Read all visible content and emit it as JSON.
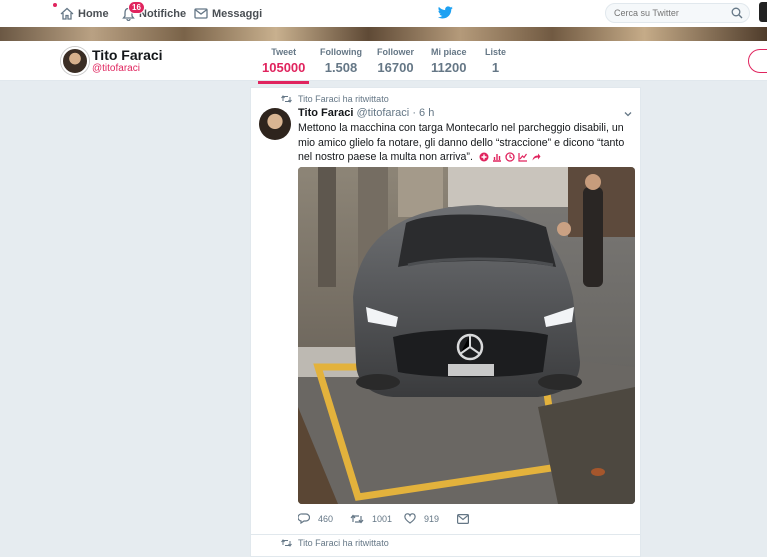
{
  "nav": {
    "home": "Home",
    "notifications": "Notifiche",
    "notifications_badge": "16",
    "messages": "Messaggi",
    "search_placeholder": "Cerca su Twitter"
  },
  "profile": {
    "name": "Tito Faraci",
    "handle": "@titofaraci",
    "stats": [
      {
        "label": "Tweet",
        "value": "105000"
      },
      {
        "label": "Following",
        "value": "1.508"
      },
      {
        "label": "Follower",
        "value": "16700"
      },
      {
        "label": "Mi piace",
        "value": "11200"
      },
      {
        "label": "Liste",
        "value": "1"
      }
    ]
  },
  "tweet": {
    "retweet_context": "Tito Faraci ha ritwittato",
    "author_name": "Tito Faraci",
    "author_handle": "@titofaraci",
    "dot": "·",
    "time": "6 h",
    "text": "Mettono la macchina con targa Montecarlo nel parcheggio disabili, un mio amico glielo fa notare, gli danno dello “straccione” e dicono “tanto nel nostro paese la multa non arriva”.",
    "replies": "460",
    "retweets": "1001",
    "likes": "919",
    "emoji_icons": [
      "heavy-plus-icon",
      "bar-chart-icon",
      "clock-icon",
      "chart-up-icon",
      "share-arrow-icon"
    ]
  },
  "next_retweet_context": "Tito Faraci ha ritwittato",
  "colors": {
    "accent": "#e0245e",
    "twitter_blue": "#1da1f2",
    "muted": "#657786",
    "background": "#e6ecf0"
  }
}
